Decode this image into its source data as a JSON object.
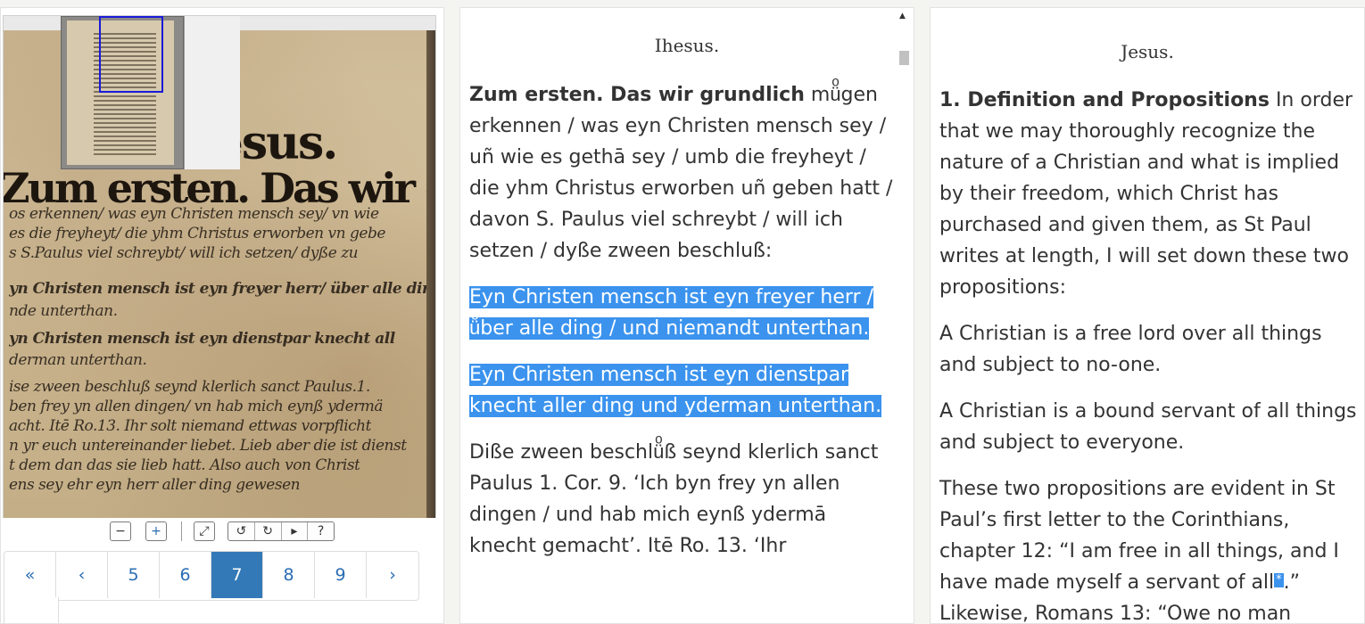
{
  "viewer": {
    "scan_lines": [
      "os erkennen/ was eyn Christen mensch sey/ vn wie",
      "es die freyheyt/ die yhm Christus erworben vn gebe",
      "s S.Paulus viel schreybt/ will ich setzen/ dyße zu",
      "yn Christen mensch ist eyn freyer herr/ über alle din",
      "nde unterthan.",
      "yn Christen mensch ist eyn dienstpar knecht all",
      "derman unterthan.",
      "ise zween beschluß seynd klerlich sanct Paulus.1.",
      "ben frey yn allen dingen/ vn hab mich eynß ydermä",
      "acht. Itē Ro.13. Ihr solt niemand ettwas vorpflicht",
      "n yr euch untereinander liebet. Lieb aber die ist dienst",
      "t dem dan das sie lieb hatt. Also auch von Christ",
      "ens sey ehr eyn herr aller ding gewesen"
    ],
    "scan_heading": "hesus.",
    "scan_subheading": "Zum ersten. Das wir grund",
    "thumb_label": "Jhesus",
    "toolbar": {
      "zoom_out": "−",
      "zoom_in": "+",
      "fit": "⤢",
      "rotate_left": "↺",
      "rotate_right": "↻",
      "next": "▸",
      "help": "?"
    },
    "pagination": [
      "«",
      "‹",
      "5",
      "6",
      "7",
      "8",
      "9",
      "›"
    ],
    "active_page": "7"
  },
  "german": {
    "title": "Ihesus.",
    "p1_bold": "Zum ersten. Das wir grundlich",
    "p1_rest": " müͦgen erkennen / was eyn Christen mensch sey / uñ wie es gethā sey / umb die freyheyt / die yhm Christus erworben uñ geben hatt / davon S. Paulus viel schreybt / will ich setzen / dyße zween beschluß:",
    "p2": "Eyn Christen mensch ist eyn freyer herr / üͦber alle ding / und niemandt unterthan.",
    "p3": "Eyn Christen mensch ist eyn dienstpar knecht aller ding und yderman unterthan.",
    "p4": "Diße zween beschlüͦß seynd klerlich sanct Paulus 1. Cor. 9. ‘Ich byn frey yn allen dingen / und hab mich eynß ydermā knecht gemacht’. Itē Ro. 13. ‘Ihr"
  },
  "english": {
    "title": "Jesus.",
    "p1_bold": "1. Definition and Propositions",
    "p1_rest": " In order that we may thoroughly recognize the nature of a Christian and what is implied by their freedom, which Christ has purchased and given them, as St Paul writes at length, I will set down these two propositions:",
    "p2": "A Christian is a free lord over all things and subject to no-one.",
    "p3": "A Christian is a bound servant of all things and subject to everyone.",
    "p4": "These two propositions are evident in St Paul’s first letter to the Corinthians, chapter 12: “I am free in all things, and I have made myself a servant of all",
    "p4_mark": "*",
    "p4_end": ".” Likewise, Romans 13: “Owe no man"
  }
}
